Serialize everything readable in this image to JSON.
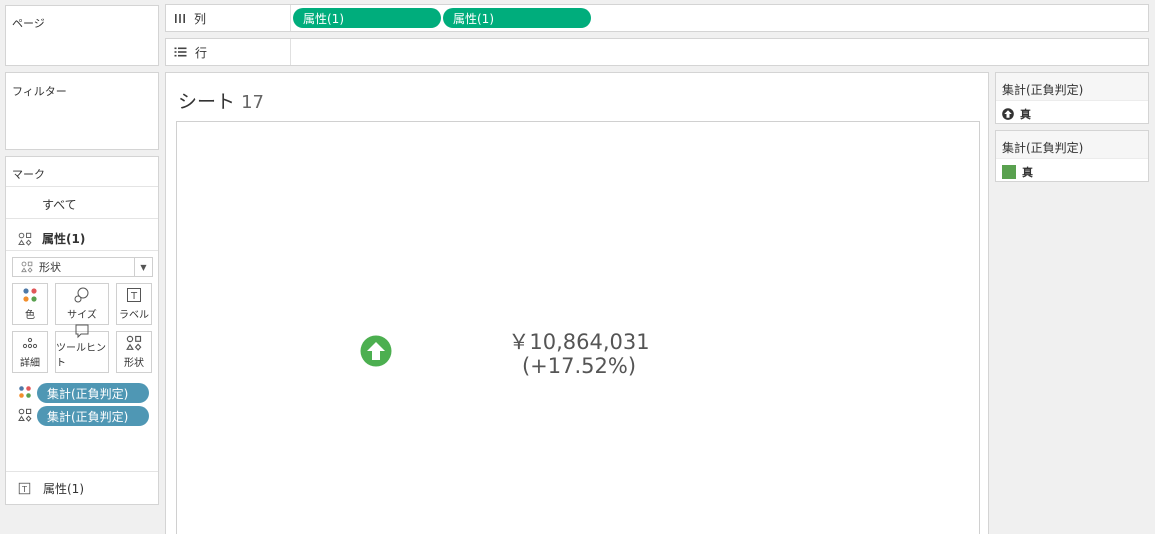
{
  "pages": {
    "title": "ページ"
  },
  "filters": {
    "title": "フィルター"
  },
  "marks": {
    "title": "マーク",
    "all_label": "すべて",
    "attr_label": "属性(1)",
    "mark_type": "形状",
    "buttons": {
      "color": "色",
      "size": "サイズ",
      "label": "ラベル",
      "detail": "詳細",
      "tooltip": "ツールヒント",
      "shape": "形状"
    },
    "pills": [
      "集計(正負判定)",
      "集計(正負判定)"
    ],
    "footer_label": "属性(1)"
  },
  "shelves": {
    "columns_label": "列",
    "rows_label": "行",
    "columns_pills": [
      "属性(1)",
      "属性(1)"
    ]
  },
  "view": {
    "title": "シート",
    "title_num": "17",
    "kpi_value": "￥10,864,031",
    "kpi_pct": "(+17.52%)"
  },
  "legends": {
    "shape": {
      "title": "集計(正負判定)",
      "item": "真"
    },
    "color": {
      "title": "集計(正負判定)",
      "item": "真",
      "swatch": "#59a14f"
    }
  },
  "colors": {
    "pill_green": "#00ad7c",
    "pill_blue": "#4f97b4",
    "arrow_green": "#4caf50"
  }
}
